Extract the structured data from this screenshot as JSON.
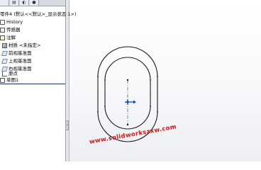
{
  "feature_manager": {
    "root_label": "零件4 (默认<<默认>_显示状态 1>)",
    "items": [
      {
        "label": "History",
        "icon": "history-icon"
      },
      {
        "label": "传感器",
        "icon": "sensor-icon"
      },
      {
        "label": "注解",
        "icon": "annotation-icon"
      },
      {
        "label": "材质 <未指定>",
        "icon": "material-icon"
      },
      {
        "label": "前视基准面",
        "icon": "plane-icon"
      },
      {
        "label": "上视基准面",
        "icon": "plane-icon"
      },
      {
        "label": "右视基准面",
        "icon": "plane-icon"
      },
      {
        "label": "原点",
        "icon": "origin-icon"
      },
      {
        "label": "草图1",
        "icon": "sketch-icon"
      }
    ]
  },
  "watermark": "www.solidworkszxw.com",
  "colors": {
    "sketch_line": "#1a1a1a",
    "centerline": "#6a6a6a",
    "origin": "#1540c8",
    "watermark": "#d01818",
    "tree_selection_line": "#1e2a6e"
  }
}
